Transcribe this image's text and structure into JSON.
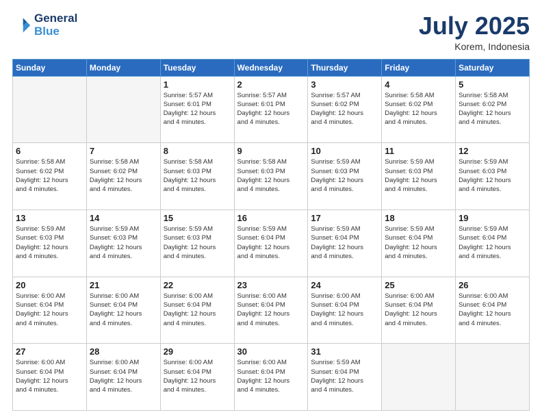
{
  "header": {
    "logo_line1": "General",
    "logo_line2": "Blue",
    "month": "July 2025",
    "location": "Korem, Indonesia"
  },
  "weekdays": [
    "Sunday",
    "Monday",
    "Tuesday",
    "Wednesday",
    "Thursday",
    "Friday",
    "Saturday"
  ],
  "weeks": [
    [
      {
        "day": "",
        "info": ""
      },
      {
        "day": "",
        "info": ""
      },
      {
        "day": "1",
        "info": "Sunrise: 5:57 AM\nSunset: 6:01 PM\nDaylight: 12 hours\nand 4 minutes."
      },
      {
        "day": "2",
        "info": "Sunrise: 5:57 AM\nSunset: 6:01 PM\nDaylight: 12 hours\nand 4 minutes."
      },
      {
        "day": "3",
        "info": "Sunrise: 5:57 AM\nSunset: 6:02 PM\nDaylight: 12 hours\nand 4 minutes."
      },
      {
        "day": "4",
        "info": "Sunrise: 5:58 AM\nSunset: 6:02 PM\nDaylight: 12 hours\nand 4 minutes."
      },
      {
        "day": "5",
        "info": "Sunrise: 5:58 AM\nSunset: 6:02 PM\nDaylight: 12 hours\nand 4 minutes."
      }
    ],
    [
      {
        "day": "6",
        "info": "Sunrise: 5:58 AM\nSunset: 6:02 PM\nDaylight: 12 hours\nand 4 minutes."
      },
      {
        "day": "7",
        "info": "Sunrise: 5:58 AM\nSunset: 6:02 PM\nDaylight: 12 hours\nand 4 minutes."
      },
      {
        "day": "8",
        "info": "Sunrise: 5:58 AM\nSunset: 6:03 PM\nDaylight: 12 hours\nand 4 minutes."
      },
      {
        "day": "9",
        "info": "Sunrise: 5:58 AM\nSunset: 6:03 PM\nDaylight: 12 hours\nand 4 minutes."
      },
      {
        "day": "10",
        "info": "Sunrise: 5:59 AM\nSunset: 6:03 PM\nDaylight: 12 hours\nand 4 minutes."
      },
      {
        "day": "11",
        "info": "Sunrise: 5:59 AM\nSunset: 6:03 PM\nDaylight: 12 hours\nand 4 minutes."
      },
      {
        "day": "12",
        "info": "Sunrise: 5:59 AM\nSunset: 6:03 PM\nDaylight: 12 hours\nand 4 minutes."
      }
    ],
    [
      {
        "day": "13",
        "info": "Sunrise: 5:59 AM\nSunset: 6:03 PM\nDaylight: 12 hours\nand 4 minutes."
      },
      {
        "day": "14",
        "info": "Sunrise: 5:59 AM\nSunset: 6:03 PM\nDaylight: 12 hours\nand 4 minutes."
      },
      {
        "day": "15",
        "info": "Sunrise: 5:59 AM\nSunset: 6:03 PM\nDaylight: 12 hours\nand 4 minutes."
      },
      {
        "day": "16",
        "info": "Sunrise: 5:59 AM\nSunset: 6:04 PM\nDaylight: 12 hours\nand 4 minutes."
      },
      {
        "day": "17",
        "info": "Sunrise: 5:59 AM\nSunset: 6:04 PM\nDaylight: 12 hours\nand 4 minutes."
      },
      {
        "day": "18",
        "info": "Sunrise: 5:59 AM\nSunset: 6:04 PM\nDaylight: 12 hours\nand 4 minutes."
      },
      {
        "day": "19",
        "info": "Sunrise: 5:59 AM\nSunset: 6:04 PM\nDaylight: 12 hours\nand 4 minutes."
      }
    ],
    [
      {
        "day": "20",
        "info": "Sunrise: 6:00 AM\nSunset: 6:04 PM\nDaylight: 12 hours\nand 4 minutes."
      },
      {
        "day": "21",
        "info": "Sunrise: 6:00 AM\nSunset: 6:04 PM\nDaylight: 12 hours\nand 4 minutes."
      },
      {
        "day": "22",
        "info": "Sunrise: 6:00 AM\nSunset: 6:04 PM\nDaylight: 12 hours\nand 4 minutes."
      },
      {
        "day": "23",
        "info": "Sunrise: 6:00 AM\nSunset: 6:04 PM\nDaylight: 12 hours\nand 4 minutes."
      },
      {
        "day": "24",
        "info": "Sunrise: 6:00 AM\nSunset: 6:04 PM\nDaylight: 12 hours\nand 4 minutes."
      },
      {
        "day": "25",
        "info": "Sunrise: 6:00 AM\nSunset: 6:04 PM\nDaylight: 12 hours\nand 4 minutes."
      },
      {
        "day": "26",
        "info": "Sunrise: 6:00 AM\nSunset: 6:04 PM\nDaylight: 12 hours\nand 4 minutes."
      }
    ],
    [
      {
        "day": "27",
        "info": "Sunrise: 6:00 AM\nSunset: 6:04 PM\nDaylight: 12 hours\nand 4 minutes."
      },
      {
        "day": "28",
        "info": "Sunrise: 6:00 AM\nSunset: 6:04 PM\nDaylight: 12 hours\nand 4 minutes."
      },
      {
        "day": "29",
        "info": "Sunrise: 6:00 AM\nSunset: 6:04 PM\nDaylight: 12 hours\nand 4 minutes."
      },
      {
        "day": "30",
        "info": "Sunrise: 6:00 AM\nSunset: 6:04 PM\nDaylight: 12 hours\nand 4 minutes."
      },
      {
        "day": "31",
        "info": "Sunrise: 5:59 AM\nSunset: 6:04 PM\nDaylight: 12 hours\nand 4 minutes."
      },
      {
        "day": "",
        "info": ""
      },
      {
        "day": "",
        "info": ""
      }
    ]
  ]
}
